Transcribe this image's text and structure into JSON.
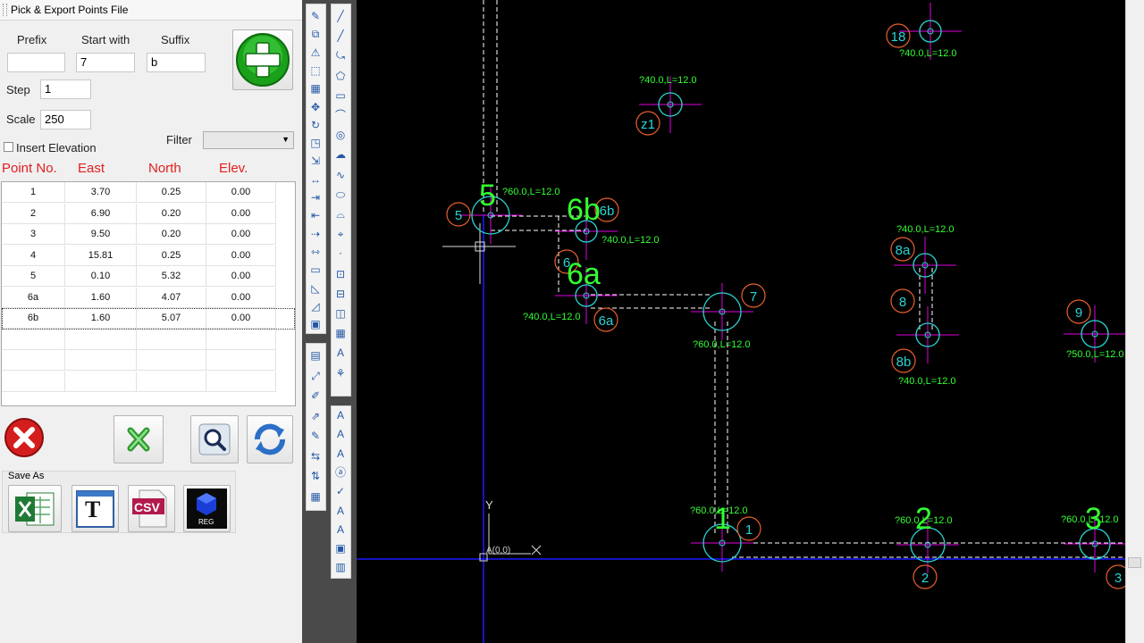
{
  "panel": {
    "title": "Pick & Export Points File",
    "prefix_label": "Prefix",
    "start_label": "Start with",
    "suffix_label": "Suffix",
    "prefix_value": "",
    "start_value": "7",
    "suffix_value": "b",
    "step_label": "Step",
    "step_value": "1",
    "scale_label": "Scale",
    "scale_value": "250",
    "insert_elevation_label": "Insert Elevation",
    "insert_elevation_checked": false,
    "filter_label": "Filter",
    "filter_value": "",
    "columns": [
      "Point No.",
      "East",
      "North",
      "Elev."
    ],
    "rows": [
      {
        "point": "1",
        "east": "3.70",
        "north": "0.25",
        "elev": "0.00"
      },
      {
        "point": "2",
        "east": "6.90",
        "north": "0.20",
        "elev": "0.00"
      },
      {
        "point": "3",
        "east": "9.50",
        "north": "0.20",
        "elev": "0.00"
      },
      {
        "point": "4",
        "east": "15.81",
        "north": "0.25",
        "elev": "0.00"
      },
      {
        "point": "5",
        "east": "0.10",
        "north": "5.32",
        "elev": "0.00"
      },
      {
        "point": "6a",
        "east": "1.60",
        "north": "4.07",
        "elev": "0.00"
      },
      {
        "point": "6b",
        "east": "1.60",
        "north": "5.07",
        "elev": "0.00"
      }
    ],
    "save_as_label": "Save As",
    "csv_label": "CSV",
    "reg_label": "REG",
    "text_icon_label": "T"
  },
  "cad": {
    "big_labels": [
      "5",
      "6b",
      "6a",
      "1",
      "2",
      "3"
    ],
    "circle_labels": [
      "18",
      "z1",
      "5",
      "6b",
      "6",
      "7",
      "6a",
      "8a",
      "8",
      "8b",
      "9",
      "1",
      "2",
      "3"
    ],
    "annotations": [
      "?40.0,L=12.0",
      "?40.0,L=12.0",
      "?60.0,L=12.0",
      "?40.0,L=12.0",
      "?40.0,L=12.0",
      "?60.0,L=12.0",
      "?40.0,L=12.0",
      "?40.0,L=12.0",
      "?50.0,L=12.0",
      "?60.0,L=12.0",
      "?60.0,L=12.0",
      "?60.0,L=12.0"
    ],
    "ucs_y_label": "Y",
    "ucs_origin_label": "A(0,0)",
    "colors": {
      "background": "#000000",
      "green_text": "#33ff33",
      "circle_orange": "#e8602c",
      "circle_cyan": "#2ad4d4",
      "axis_blue": "#1a1aff",
      "magenta": "#e000e0"
    }
  }
}
